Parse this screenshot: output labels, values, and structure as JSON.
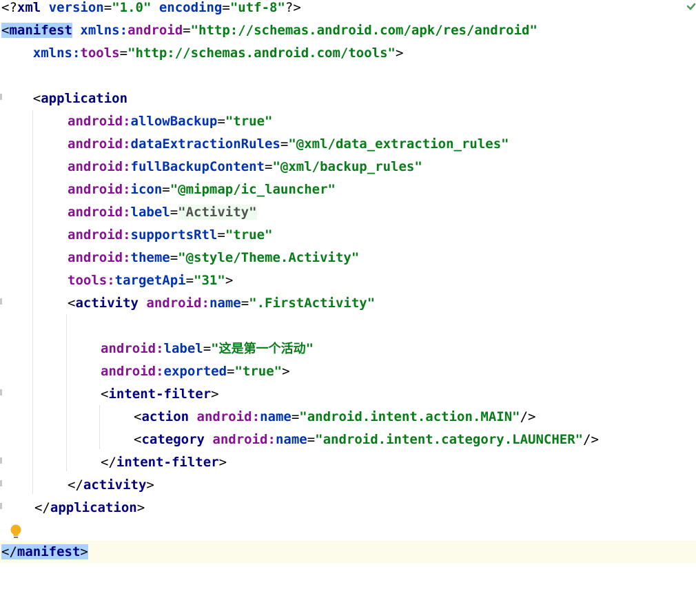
{
  "editor": {
    "file_lines": [
      {
        "text": "<?xml version=\"1.0\" encoding=\"utf-8\"?>"
      },
      {
        "text": "<manifest xmlns:android=\"http://schemas.android.com/apk/res/android\""
      },
      {
        "text": "    xmlns:tools=\"http://schemas.android.com/tools\">"
      },
      {
        "text": ""
      },
      {
        "text": "    <application"
      },
      {
        "text": "        android:allowBackup=\"true\""
      },
      {
        "text": "        android:dataExtractionRules=\"@xml/data_extraction_rules\""
      },
      {
        "text": "        android:fullBackupContent=\"@xml/backup_rules\""
      },
      {
        "text": "        android:icon=\"@mipmap/ic_launcher\""
      },
      {
        "text": "        android:label=\"Activity\""
      },
      {
        "text": "        android:supportsRtl=\"true\""
      },
      {
        "text": "        android:theme=\"@style/Theme.Activity\""
      },
      {
        "text": "        tools:targetApi=\"31\">"
      },
      {
        "text": "        <activity android:name=\".FirstActivity\""
      },
      {
        "text": ""
      },
      {
        "text": "            android:label=\"这是第一个活动\""
      },
      {
        "text": "            android:exported=\"true\">"
      },
      {
        "text": "            <intent-filter>"
      },
      {
        "text": "                <action android:name=\"android.intent.action.MAIN\"/>"
      },
      {
        "text": "                <category android:name=\"android.intent.category.LAUNCHER\"/>"
      },
      {
        "text": "            </intent-filter>"
      },
      {
        "text": "        </activity>"
      },
      {
        "text": "    </application>"
      },
      {
        "text": ""
      },
      {
        "text": "</manifest>"
      }
    ],
    "tokens": {
      "l1_a": "<?",
      "l1_b": "xml",
      "l1_c": " ",
      "l1_d": "version",
      "l1_e": "=",
      "l1_f": "\"1.0\"",
      "l1_g": " ",
      "l1_h": "encoding",
      "l1_i": "=",
      "l1_j": "\"utf-8\"",
      "l1_k": "?>",
      "l2_a": "<",
      "l2_b": "manifest",
      "l2_c": " ",
      "l2_d": "xmlns:",
      "l2_e": "android",
      "l2_f": "=",
      "l2_g": "\"http://schemas.android.com/apk/res/android\"",
      "l3_a": "    ",
      "l3_b": "xmlns:",
      "l3_c": "tools",
      "l3_d": "=",
      "l3_e": "\"http://schemas.android.com/tools\"",
      "l3_f": ">",
      "l5_a": "    ",
      "l5_b": "<",
      "l5_c": "application",
      "l6_ns": "android:",
      "l6_at": "allowBackup",
      "l6_eq": "=",
      "l6_v": "\"true\"",
      "l7_ns": "android:",
      "l7_at": "dataExtractionRules",
      "l7_eq": "=",
      "l7_v": "\"@xml/data_extraction_rules\"",
      "l8_ns": "android:",
      "l8_at": "fullBackupContent",
      "l8_eq": "=",
      "l8_v": "\"@xml/backup_rules\"",
      "l9_ns": "android:",
      "l9_at": "icon",
      "l9_eq": "=",
      "l9_v": "\"@mipmap/ic_launcher\"",
      "l10_ns": "android:",
      "l10_at": "label",
      "l10_eq": "=",
      "l10_v": "\"Activity\"",
      "l11_ns": "android:",
      "l11_at": "supportsRtl",
      "l11_eq": "=",
      "l11_v": "\"true\"",
      "l12_ns": "android:",
      "l12_at": "theme",
      "l12_eq": "=",
      "l12_v": "\"@style/Theme.Activity\"",
      "l13_ns": "tools:",
      "l13_at": "targetApi",
      "l13_eq": "=",
      "l13_v": "\"31\"",
      "l13_end": ">",
      "l14_lt": "<",
      "l14_tag": "activity",
      "l14_sp": " ",
      "l14_ns": "android:",
      "l14_at": "name",
      "l14_eq": "=",
      "l14_v": "\".FirstActivity\"",
      "l16_ns": "android:",
      "l16_at": "label",
      "l16_eq": "=",
      "l16_q1": "\"",
      "l16_v": "这是第一个活动",
      "l16_q2": "\"",
      "l17_ns": "android:",
      "l17_at": "exported",
      "l17_eq": "=",
      "l17_v": "\"true\"",
      "l17_end": ">",
      "l18_lt": "<",
      "l18_tag": "intent-filter",
      "l18_gt": ">",
      "l19_lt": "<",
      "l19_tag": "action",
      "l19_sp": " ",
      "l19_ns": "android:",
      "l19_at": "name",
      "l19_eq": "=",
      "l19_v": "\"android.intent.action.MAIN\"",
      "l19_end": "/>",
      "l20_lt": "<",
      "l20_tag": "category",
      "l20_sp": " ",
      "l20_ns": "android:",
      "l20_at": "name",
      "l20_eq": "=",
      "l20_v": "\"android.intent.category.LAUNCHER\"",
      "l20_end": "/>",
      "l21_lt": "</",
      "l21_tag": "intent-filter",
      "l21_gt": ">",
      "l22_lt": "</",
      "l22_tag": "activity",
      "l22_gt": ">",
      "l23_lt": "</",
      "l23_tag": "application",
      "l23_gt": ">",
      "l25_lt": "</",
      "l25_tag": "manifest",
      "l25_gt": ">"
    }
  },
  "icons": {
    "intention": "lightbulb-icon",
    "inspection": "checkmark-icon"
  },
  "colors": {
    "tag": "#000080",
    "namespace": "#871094",
    "attribute": "#0033b3",
    "value": "#067d17",
    "tag_highlight": "#a8d1ff",
    "current_line": "#fdfbea",
    "bulb": "#f2b01e",
    "check": "#4a9a5c"
  }
}
